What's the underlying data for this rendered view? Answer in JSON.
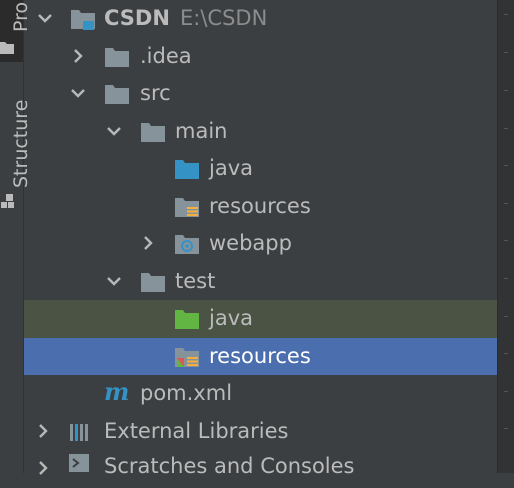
{
  "tool_window": {
    "tabs": [
      {
        "label": "Pro"
      },
      {
        "label": "Structure"
      }
    ]
  },
  "tree": {
    "root": {
      "label": "CSDN",
      "path": "E:\\CSDN"
    },
    "idea": {
      "label": ".idea"
    },
    "src": {
      "label": "src"
    },
    "main": {
      "label": "main"
    },
    "main_java": {
      "label": "java"
    },
    "main_resources": {
      "label": "resources"
    },
    "webapp": {
      "label": "webapp"
    },
    "test": {
      "label": "test"
    },
    "test_java": {
      "label": "java"
    },
    "test_resources": {
      "label": "resources"
    },
    "pom": {
      "label": "pom.xml"
    },
    "external_libraries": {
      "label": "External Libraries"
    },
    "scratches": {
      "label": "Scratches and Consoles"
    }
  },
  "colors": {
    "background": "#3c3f41",
    "selection_blue": "#4b6eaf",
    "selection_green": "#4b5344",
    "folder_gray": "#87939a",
    "source_blue": "#3592c4",
    "test_green": "#62b543",
    "maven_blue": "#3592c4"
  }
}
